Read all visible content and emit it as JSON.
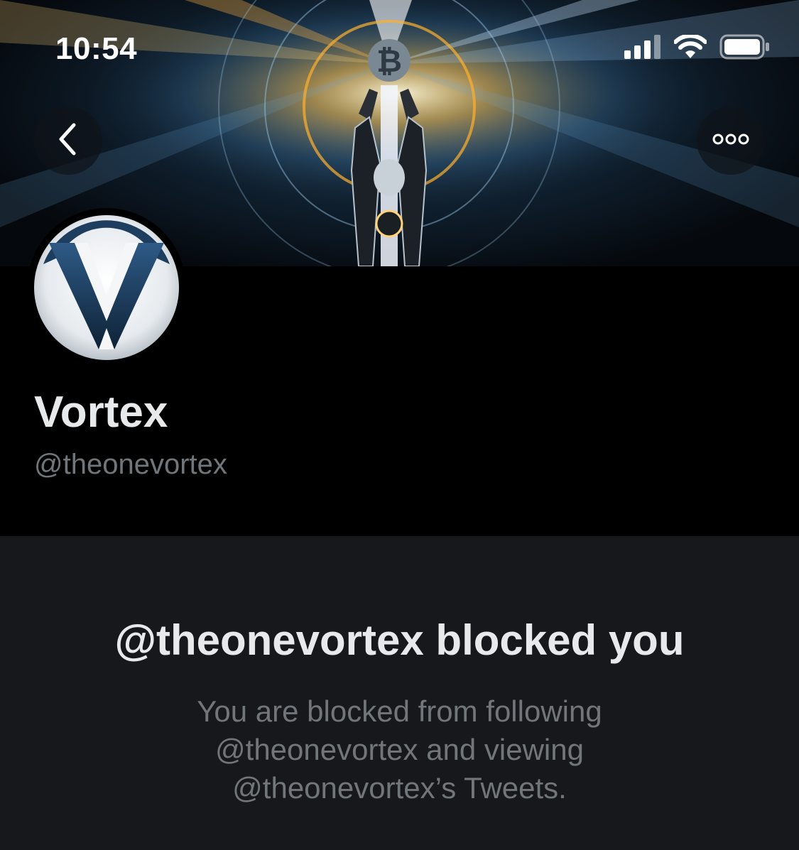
{
  "status_bar": {
    "time": "10:54",
    "icons": [
      "cellular-signal-icon",
      "wifi-icon",
      "battery-icon"
    ]
  },
  "header": {
    "back_icon": "chevron-left-icon",
    "more_icon": "more-horizontal-icon"
  },
  "profile": {
    "display_name": "Vortex",
    "handle": "@theonevortex"
  },
  "blocked_notice": {
    "title": "@theonevortex blocked you",
    "message": "You are blocked from following @theonevortex and viewing @theonevortex’s Tweets."
  },
  "colors": {
    "background": "#000000",
    "panel": "#16181c",
    "primary_text": "#e7e9ea",
    "secondary_text": "#71767b"
  }
}
